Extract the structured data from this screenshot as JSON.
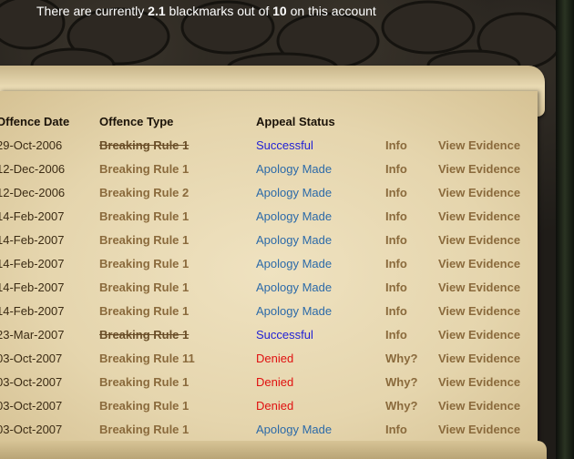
{
  "header": {
    "prefix": "There are currently ",
    "current": "2.1",
    "middle": " blackmarks out of ",
    "max": "10",
    "suffix": " on this account"
  },
  "table": {
    "headers": {
      "date": "Offence Date",
      "type": "Offence Type",
      "status": "Appeal Status"
    },
    "rows": [
      {
        "date": "29-Oct-2006",
        "type": "Breaking Rule 1",
        "status": "Successful",
        "status_kind": "successful",
        "info": "Info",
        "evidence": "View Evidence",
        "struck": true
      },
      {
        "date": "12-Dec-2006",
        "type": "Breaking Rule 1",
        "status": "Apology Made",
        "status_kind": "apology",
        "info": "Info",
        "evidence": "View Evidence",
        "struck": false
      },
      {
        "date": "12-Dec-2006",
        "type": "Breaking Rule 2",
        "status": "Apology Made",
        "status_kind": "apology",
        "info": "Info",
        "evidence": "View Evidence",
        "struck": false
      },
      {
        "date": "14-Feb-2007",
        "type": "Breaking Rule 1",
        "status": "Apology Made",
        "status_kind": "apology",
        "info": "Info",
        "evidence": "View Evidence",
        "struck": false
      },
      {
        "date": "14-Feb-2007",
        "type": "Breaking Rule 1",
        "status": "Apology Made",
        "status_kind": "apology",
        "info": "Info",
        "evidence": "View Evidence",
        "struck": false
      },
      {
        "date": "14-Feb-2007",
        "type": "Breaking Rule 1",
        "status": "Apology Made",
        "status_kind": "apology",
        "info": "Info",
        "evidence": "View Evidence",
        "struck": false
      },
      {
        "date": "14-Feb-2007",
        "type": "Breaking Rule 1",
        "status": "Apology Made",
        "status_kind": "apology",
        "info": "Info",
        "evidence": "View Evidence",
        "struck": false
      },
      {
        "date": "14-Feb-2007",
        "type": "Breaking Rule 1",
        "status": "Apology Made",
        "status_kind": "apology",
        "info": "Info",
        "evidence": "View Evidence",
        "struck": false
      },
      {
        "date": "23-Mar-2007",
        "type": "Breaking Rule 1",
        "status": "Successful",
        "status_kind": "successful",
        "info": "Info",
        "evidence": "View Evidence",
        "struck": true
      },
      {
        "date": "03-Oct-2007",
        "type": "Breaking Rule 11",
        "status": "Denied",
        "status_kind": "denied",
        "info": "Why?",
        "evidence": "View Evidence",
        "struck": false
      },
      {
        "date": "03-Oct-2007",
        "type": "Breaking Rule 1",
        "status": "Denied",
        "status_kind": "denied",
        "info": "Why?",
        "evidence": "View Evidence",
        "struck": false
      },
      {
        "date": "03-Oct-2007",
        "type": "Breaking Rule 1",
        "status": "Denied",
        "status_kind": "denied",
        "info": "Why?",
        "evidence": "View Evidence",
        "struck": false
      },
      {
        "date": "03-Oct-2007",
        "type": "Breaking Rule 1",
        "status": "Apology Made",
        "status_kind": "apology",
        "info": "Info",
        "evidence": "View Evidence",
        "struck": false
      }
    ]
  }
}
